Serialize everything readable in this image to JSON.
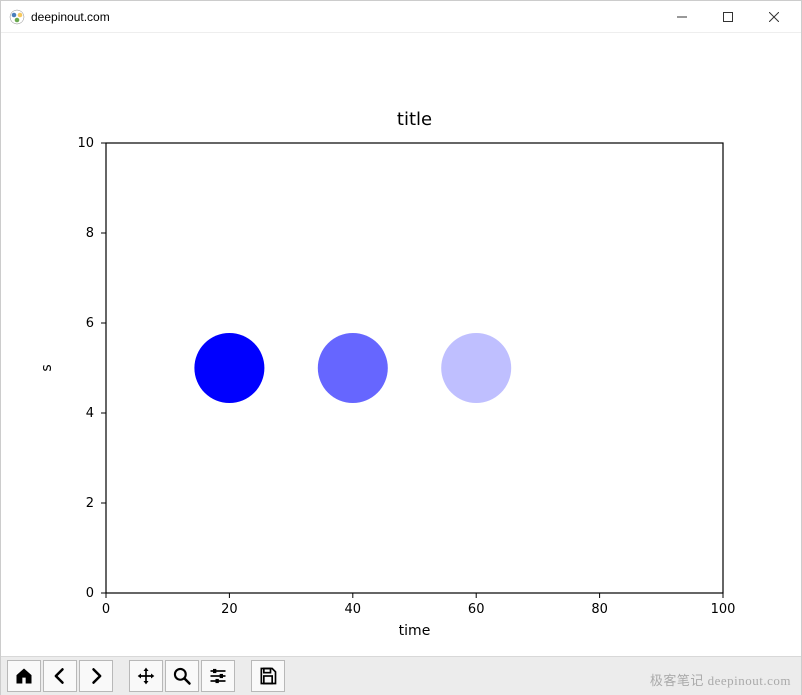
{
  "window": {
    "title": "deepinout.com"
  },
  "chart_data": {
    "type": "scatter",
    "title": "title",
    "xlabel": "time",
    "ylabel": "s",
    "xlim": [
      0,
      100
    ],
    "ylim": [
      0,
      10
    ],
    "xticks": [
      0,
      20,
      40,
      60,
      80,
      100
    ],
    "yticks": [
      0,
      2,
      4,
      6,
      8,
      10
    ],
    "points": [
      {
        "x": 20,
        "y": 5,
        "alpha": 1.0,
        "color": "#0000ff"
      },
      {
        "x": 40,
        "y": 5,
        "alpha": 0.6,
        "color": "#0000ff"
      },
      {
        "x": 60,
        "y": 5,
        "alpha": 0.25,
        "color": "#0000ff"
      }
    ],
    "marker_radius_px": 35
  },
  "toolbar": {
    "home": "Home",
    "back": "Back",
    "forward": "Forward",
    "pan": "Pan",
    "zoom": "Zoom",
    "configure": "Configure subplots",
    "save": "Save"
  },
  "watermark": "极客笔记 deepinout.com"
}
